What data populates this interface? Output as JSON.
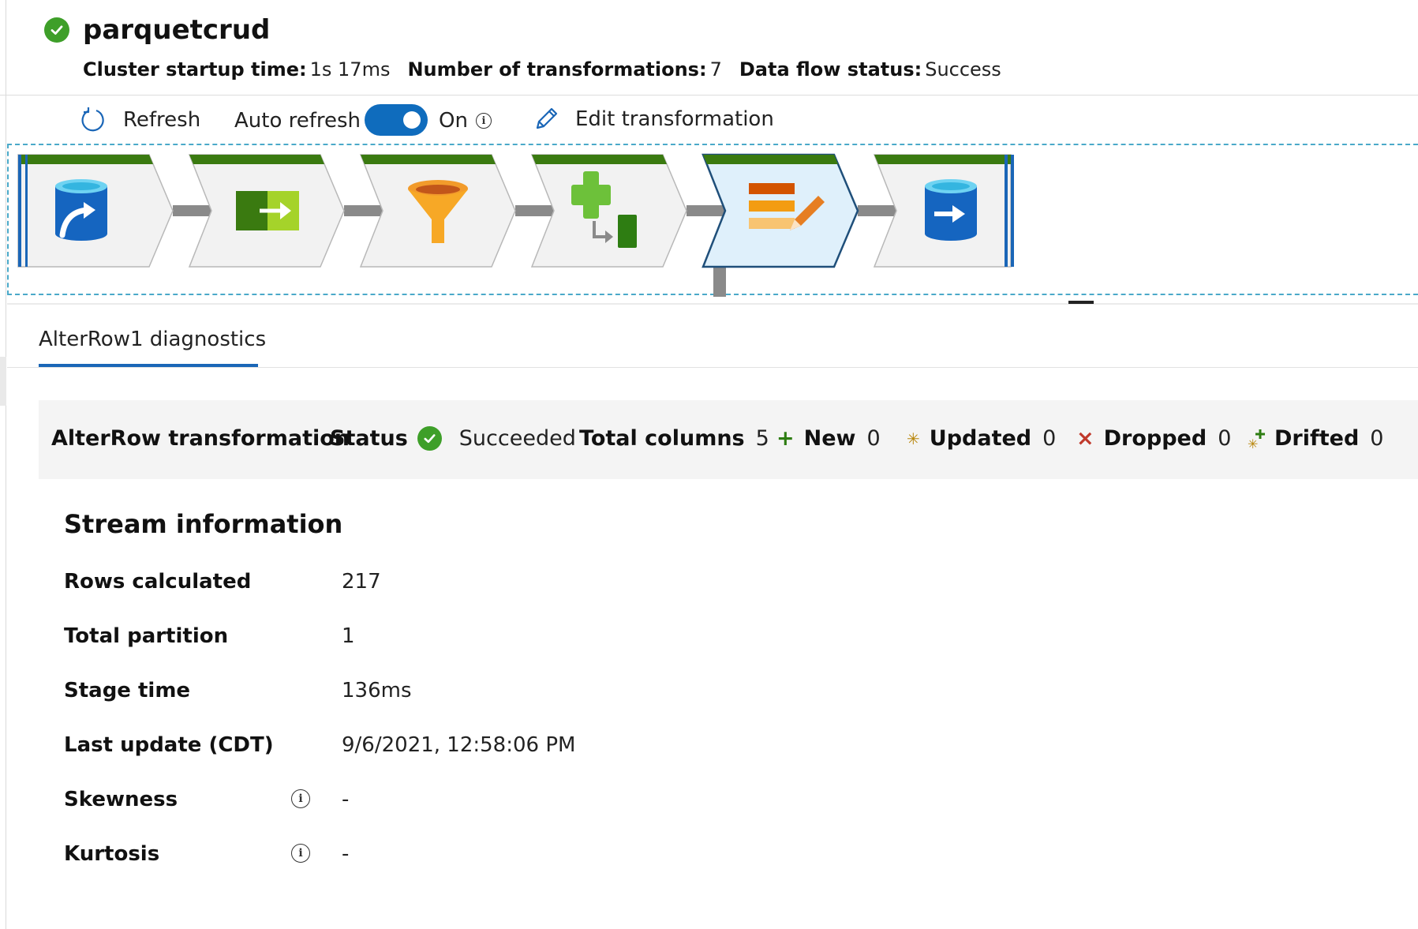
{
  "header": {
    "title": "parquetcrud",
    "meta": [
      {
        "label": "Cluster startup time:",
        "value": "1s 17ms"
      },
      {
        "label": "Number of transformations:",
        "value": "7"
      },
      {
        "label": "Data flow status:",
        "value": "Success"
      }
    ]
  },
  "toolbar": {
    "refresh_label": "Refresh",
    "auto_refresh_label": "Auto refresh",
    "auto_refresh_state": "On",
    "edit_label": "Edit transformation"
  },
  "flow": {
    "nodes": [
      {
        "icon": "source-database-icon",
        "selected": false
      },
      {
        "icon": "select-transform-icon",
        "selected": false
      },
      {
        "icon": "filter-funnel-icon",
        "selected": false
      },
      {
        "icon": "derived-column-icon",
        "selected": false
      },
      {
        "icon": "alter-row-icon",
        "selected": true
      },
      {
        "icon": "sink-database-icon",
        "selected": false
      }
    ],
    "colors": {
      "status_bar": "#3a7a10",
      "node_bg": "#f2f2f2",
      "selected_bg": "#dff0fb",
      "connector": "#8a8a8a",
      "accent": "#1a66b7"
    }
  },
  "tab": {
    "label": "AlterRow1 diagnostics"
  },
  "summary": {
    "transformation_label": "AlterRow transformation",
    "status_label": "Status",
    "status_value": "Succeeded",
    "total_columns_label": "Total columns",
    "total_columns_value": "5",
    "new_label": "New",
    "new_value": "0",
    "new_glyph": "+",
    "updated_label": "Updated",
    "updated_value": "0",
    "updated_glyph": "✳",
    "dropped_label": "Dropped",
    "dropped_value": "0",
    "dropped_glyph": "×",
    "drifted_label": "Drifted",
    "drifted_value": "0"
  },
  "stream": {
    "title": "Stream information",
    "rows": [
      {
        "label": "Rows calculated",
        "value": "217"
      },
      {
        "label": "Total partition",
        "value": "1"
      },
      {
        "label": "Stage time",
        "value": "136ms"
      },
      {
        "label": "Last update (CDT)",
        "value": "9/6/2021, 12:58:06 PM"
      },
      {
        "label": "Skewness",
        "value": "-"
      },
      {
        "label": "Kurtosis",
        "value": "-"
      }
    ]
  }
}
